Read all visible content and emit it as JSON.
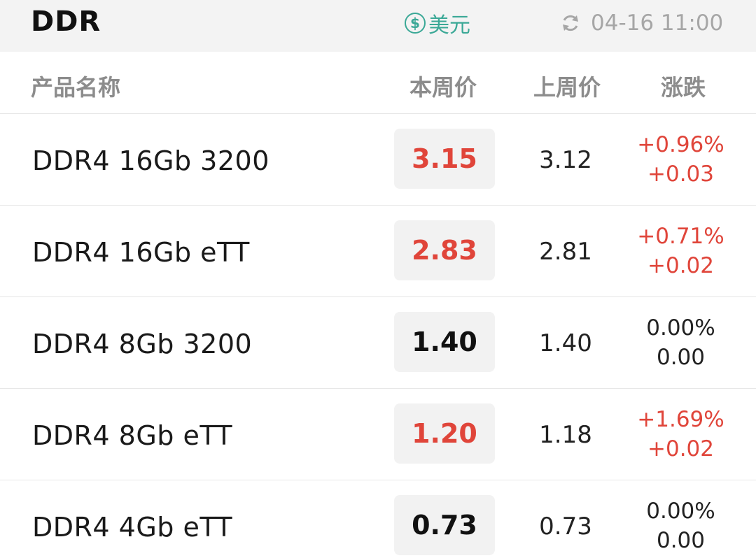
{
  "header": {
    "title": "DDR",
    "currency_symbol": "$",
    "currency_label": "美元",
    "refresh_icon": "refresh-icon",
    "updated_time": "04-16 11:00"
  },
  "columns": {
    "name": "产品名称",
    "this_week": "本周价",
    "last_week": "上周价",
    "change": "涨跌"
  },
  "colors": {
    "up": "#e0453a",
    "neutral": "#111111",
    "accent": "#3aa896"
  },
  "rows": [
    {
      "name": "DDR4 16Gb 3200",
      "this_week": "3.15",
      "last_week": "3.12",
      "change_pct": "+0.96%",
      "change_abs": "+0.03",
      "direction": "up"
    },
    {
      "name": "DDR4 16Gb eTT",
      "this_week": "2.83",
      "last_week": "2.81",
      "change_pct": "+0.71%",
      "change_abs": "+0.02",
      "direction": "up"
    },
    {
      "name": "DDR4 8Gb 3200",
      "this_week": "1.40",
      "last_week": "1.40",
      "change_pct": "0.00%",
      "change_abs": "0.00",
      "direction": "flat"
    },
    {
      "name": "DDR4 8Gb eTT",
      "this_week": "1.20",
      "last_week": "1.18",
      "change_pct": "+1.69%",
      "change_abs": "+0.02",
      "direction": "up"
    },
    {
      "name": "DDR4 4Gb eTT",
      "this_week": "0.73",
      "last_week": "0.73",
      "change_pct": "0.00%",
      "change_abs": "0.00",
      "direction": "flat"
    }
  ]
}
